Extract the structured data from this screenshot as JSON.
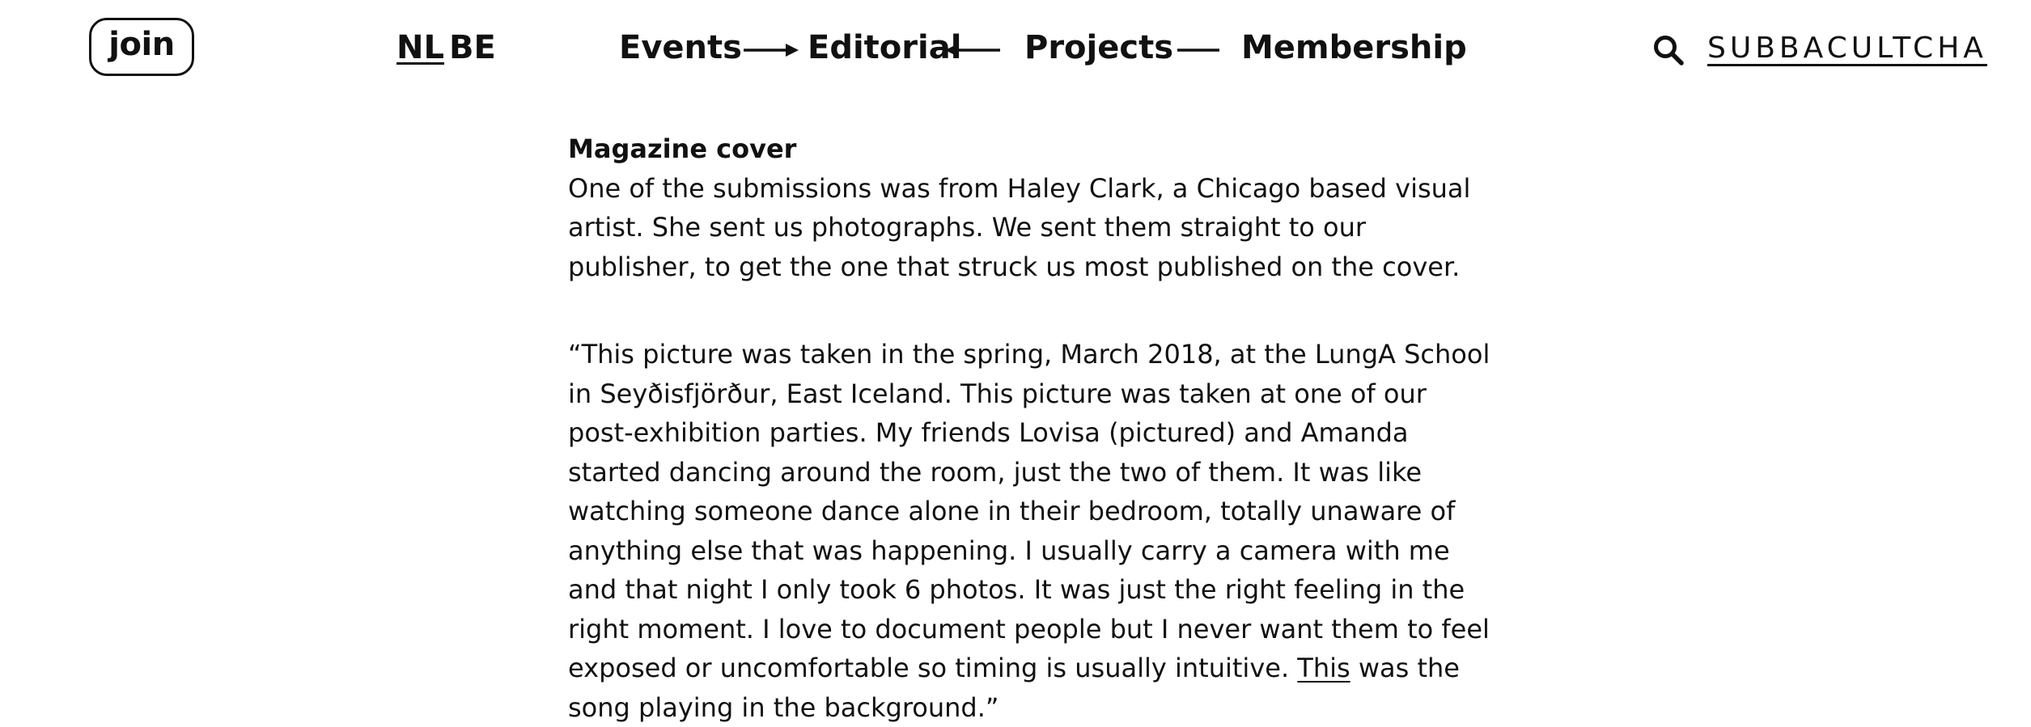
{
  "header": {
    "join_label": "join",
    "languages": {
      "nl": "NL",
      "be": "BE"
    },
    "nav": {
      "events": "Events",
      "editorial": "Editorial",
      "projects": "Projects",
      "membership": "Membership"
    },
    "search_icon": "search-icon",
    "site_name": "SUBBACULTCHA"
  },
  "article": {
    "heading": "Magazine cover",
    "intro": "One of the submissions was from Haley Clark, a Chicago based visual artist. She sent us photographs. We sent them straight  to our publisher, to get the one that struck us most published on the cover.",
    "quote_before_link": "“This picture was taken in the spring, March 2018, at the LungA School in Seyðisfjörður, East Iceland. This picture was taken at one of our post-exhibition parties. My friends Lovisa (pictured) and Amanda started dancing around the room, just the two of them. It was like watching someone dance alone in their bedroom, totally unaware of anything else that was happening. I usually carry a camera with me and that night I only took 6 photos. It was just the right feeling in the right moment. I love to document people but I never want them to feel exposed or uncomfortable so timing is usually intuitive. ",
    "quote_link": "This",
    "quote_after_link": " was the song playing in the background.”"
  }
}
